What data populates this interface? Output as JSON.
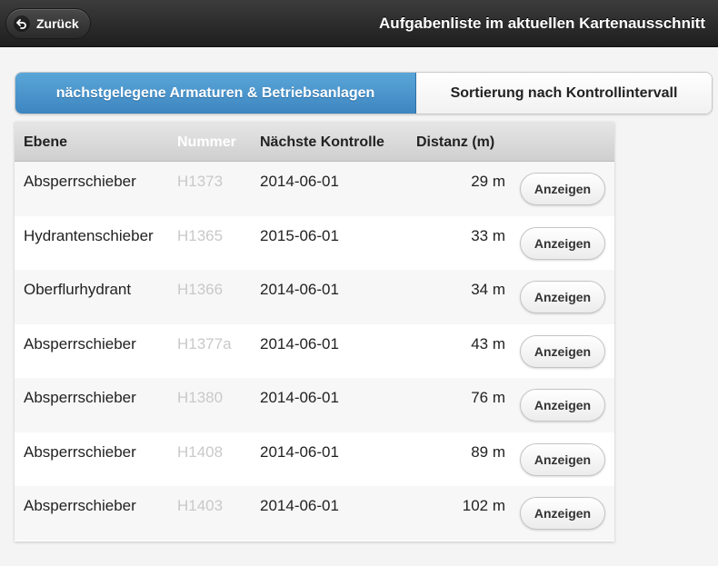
{
  "header": {
    "back_label": "Zurück",
    "title": "Aufgabenliste im aktuellen Kartenausschnitt"
  },
  "tabs": [
    {
      "label": "nächstgelegene Armaturen & Betriebsanlagen",
      "active": true
    },
    {
      "label": "Sortierung nach Kontrollintervall",
      "active": false
    }
  ],
  "table": {
    "columns": [
      "Ebene",
      "Nummer",
      "Nächste Kontrolle",
      "Distanz (m)"
    ],
    "action_label": "Anzeigen",
    "rows": [
      {
        "ebene": "Absperrschieber",
        "nummer": "H1373",
        "kontrolle": "2014-06-01",
        "distanz": "29 m"
      },
      {
        "ebene": "Hydrantenschieber",
        "nummer": "H1365",
        "kontrolle": "2015-06-01",
        "distanz": "33 m"
      },
      {
        "ebene": "Oberflurhydrant",
        "nummer": "H1366",
        "kontrolle": "2014-06-01",
        "distanz": "34 m"
      },
      {
        "ebene": "Absperrschieber",
        "nummer": "H1377a",
        "kontrolle": "2014-06-01",
        "distanz": "43 m"
      },
      {
        "ebene": "Absperrschieber",
        "nummer": "H1380",
        "kontrolle": "2014-06-01",
        "distanz": "76 m"
      },
      {
        "ebene": "Absperrschieber",
        "nummer": "H1408",
        "kontrolle": "2014-06-01",
        "distanz": "89 m"
      },
      {
        "ebene": "Absperrschieber",
        "nummer": "H1403",
        "kontrolle": "2014-06-01",
        "distanz": "102 m"
      }
    ]
  },
  "colors": {
    "header_bg": "#2a2a2a",
    "tab_active": "#4a96cf",
    "muted_text": "#c9c9c9"
  },
  "icons": {
    "back": "back-arrow-icon"
  }
}
